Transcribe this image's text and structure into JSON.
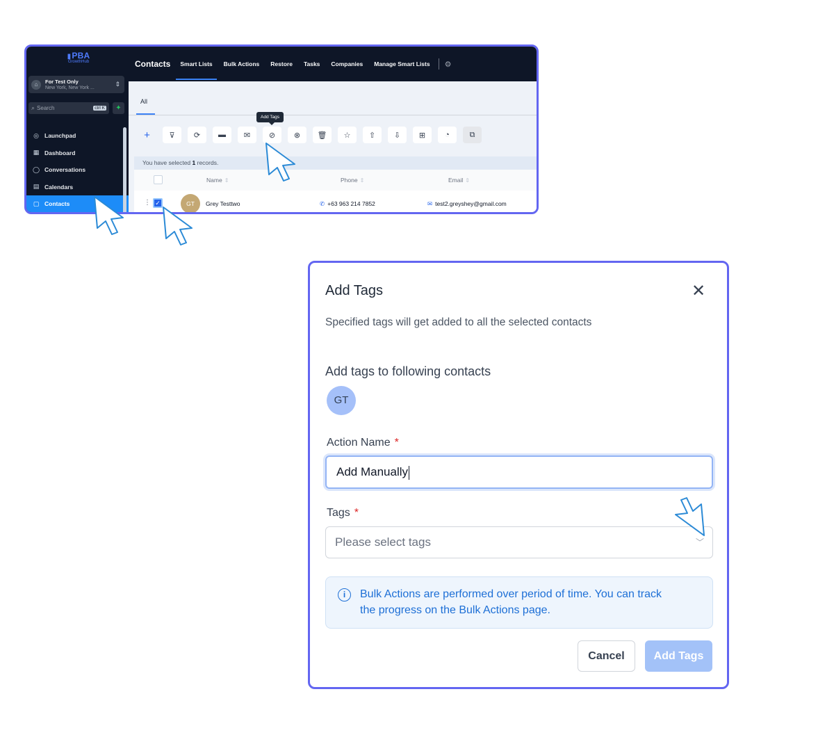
{
  "sidebar": {
    "logo_main": "PBA",
    "logo_sub": "GrowthHub",
    "account_name": "For Test Only",
    "account_location": "New York, New York ...",
    "search_placeholder": "Search",
    "search_shortcut": "ctrl K",
    "items": [
      {
        "label": "Launchpad",
        "icon": "rocket-icon"
      },
      {
        "label": "Dashboard",
        "icon": "dashboard-icon"
      },
      {
        "label": "Conversations",
        "icon": "chat-icon"
      },
      {
        "label": "Calendars",
        "icon": "calendar-icon"
      },
      {
        "label": "Contacts",
        "icon": "contacts-icon",
        "active": true
      }
    ]
  },
  "topnav": {
    "title": "Contacts",
    "tabs": [
      "Smart Lists",
      "Bulk Actions",
      "Restore",
      "Tasks",
      "Companies",
      "Manage Smart Lists"
    ],
    "active_tab": "Smart Lists"
  },
  "content": {
    "tab_all": "All",
    "tooltip": "Add Tags",
    "toolbar_icons": [
      "plus-icon",
      "filter-icon",
      "automation-icon",
      "sms-icon",
      "email-icon",
      "add-tag-icon",
      "remove-tag-icon",
      "delete-icon",
      "star-icon",
      "export-icon",
      "import-icon",
      "merge-icon",
      "whatsapp-icon",
      "duplicate-icon"
    ],
    "records_prefix": "You have selected ",
    "records_count": "1",
    "records_suffix": " records.",
    "columns": [
      "Name",
      "Phone",
      "Email"
    ],
    "row": {
      "initials": "GT",
      "name": "Grey Testtwo",
      "phone": "+63 963 214 7852",
      "email": "test2.greyshey@gmail.com",
      "selected": true
    }
  },
  "modal": {
    "title": "Add Tags",
    "description": "Specified tags will get added to all the selected contacts",
    "subtitle": "Add tags to following contacts",
    "contact_initials": "GT",
    "action_name_label": "Action Name",
    "action_name_value": "Add Manually",
    "tags_label": "Tags",
    "tags_placeholder": "Please select tags",
    "required_mark": "*",
    "info_line1": "Bulk Actions are performed over period of time. You can track",
    "info_line2": "the progress on the Bulk Actions page.",
    "cancel_label": "Cancel",
    "submit_label": "Add Tags"
  },
  "colors": {
    "frame_border": "#6366f1",
    "sidebar_bg": "#0e1627",
    "accent": "#1d8cf8",
    "info_text": "#1d6fd6",
    "submit_bg": "#a3c2f8"
  }
}
